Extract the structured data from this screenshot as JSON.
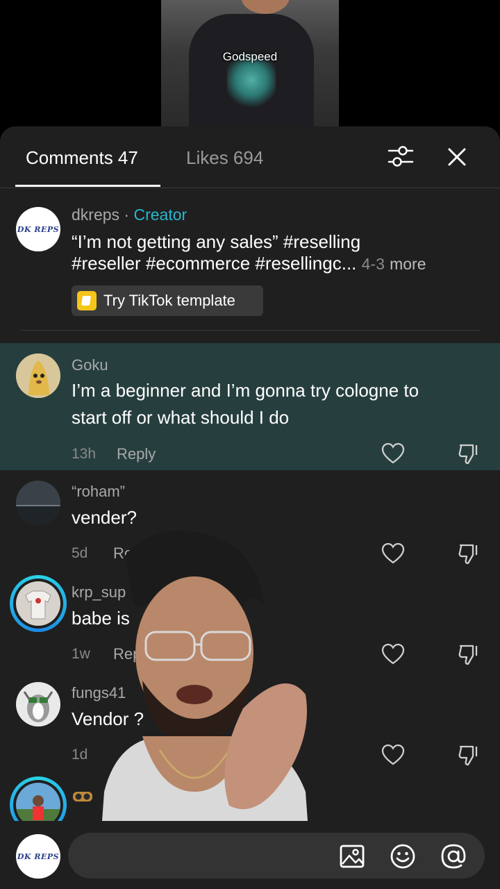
{
  "video": {
    "caption": "Godspeed"
  },
  "sheet": {
    "tabs": [
      {
        "label": "Comments 47",
        "active": true
      },
      {
        "label": "Likes 694",
        "active": false
      }
    ]
  },
  "creator_post": {
    "username": "dkreps",
    "separator": " · ",
    "badge": "Creator",
    "line1": "“I’m not getting any sales”  #reselling",
    "line2": "#reseller #ecommerce #resellingc...",
    "date": "4-3",
    "more": "more",
    "template_label": "Try TikTok template",
    "avatar_text": "DK REPS"
  },
  "comments": [
    {
      "username": "Goku",
      "lines": [
        "I’m a beginner and I’m gonna try cologne to",
        "start off or what should I do"
      ],
      "time": "13h",
      "reply": "Reply"
    },
    {
      "username": "“roham”",
      "lines": [
        "vender?"
      ],
      "time": "5d",
      "reply": "Reply"
    },
    {
      "username": "krp_sup",
      "lines": [
        "babe is"
      ],
      "time": "1w",
      "reply": "Rep"
    },
    {
      "username": "fungs41",
      "lines": [
        "Vendor ?"
      ],
      "time": "1d",
      "reply": ""
    }
  ],
  "input_bar": {
    "avatar_text": "DK REPS"
  },
  "colors": {
    "sheet_bg": "#1f1f1f",
    "highlight_bg": "#263f3e",
    "creator_badge": "#27b7cf",
    "story_ring": "#2bd4e6"
  }
}
